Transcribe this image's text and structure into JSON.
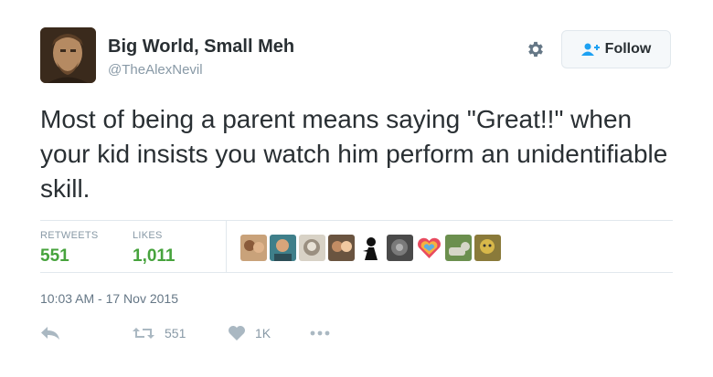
{
  "user": {
    "display_name": "Big World, Small Meh",
    "handle": "@TheAlexNevil"
  },
  "header": {
    "follow_label": "Follow"
  },
  "tweet": {
    "text": "Most of being a parent means saying \"Great!!\" when your kid insists you watch him perform an unidentifiable skill.",
    "timestamp": "10:03 AM - 17 Nov 2015"
  },
  "stats": {
    "retweets_label": "RETWEETS",
    "retweets_value": "551",
    "likes_label": "LIKES",
    "likes_value": "1,011"
  },
  "actions": {
    "retweet_count": "551",
    "like_count": "1K"
  },
  "colors": {
    "stat_green": "#47a33d",
    "secondary_text": "#8899a6",
    "follow_icon_blue": "#1da1f2",
    "divider": "#e1e8ed"
  },
  "icons": [
    "gear-icon",
    "follow-user-plus-icon",
    "reply-icon",
    "retweet-icon",
    "heart-icon",
    "more-dots-icon"
  ]
}
